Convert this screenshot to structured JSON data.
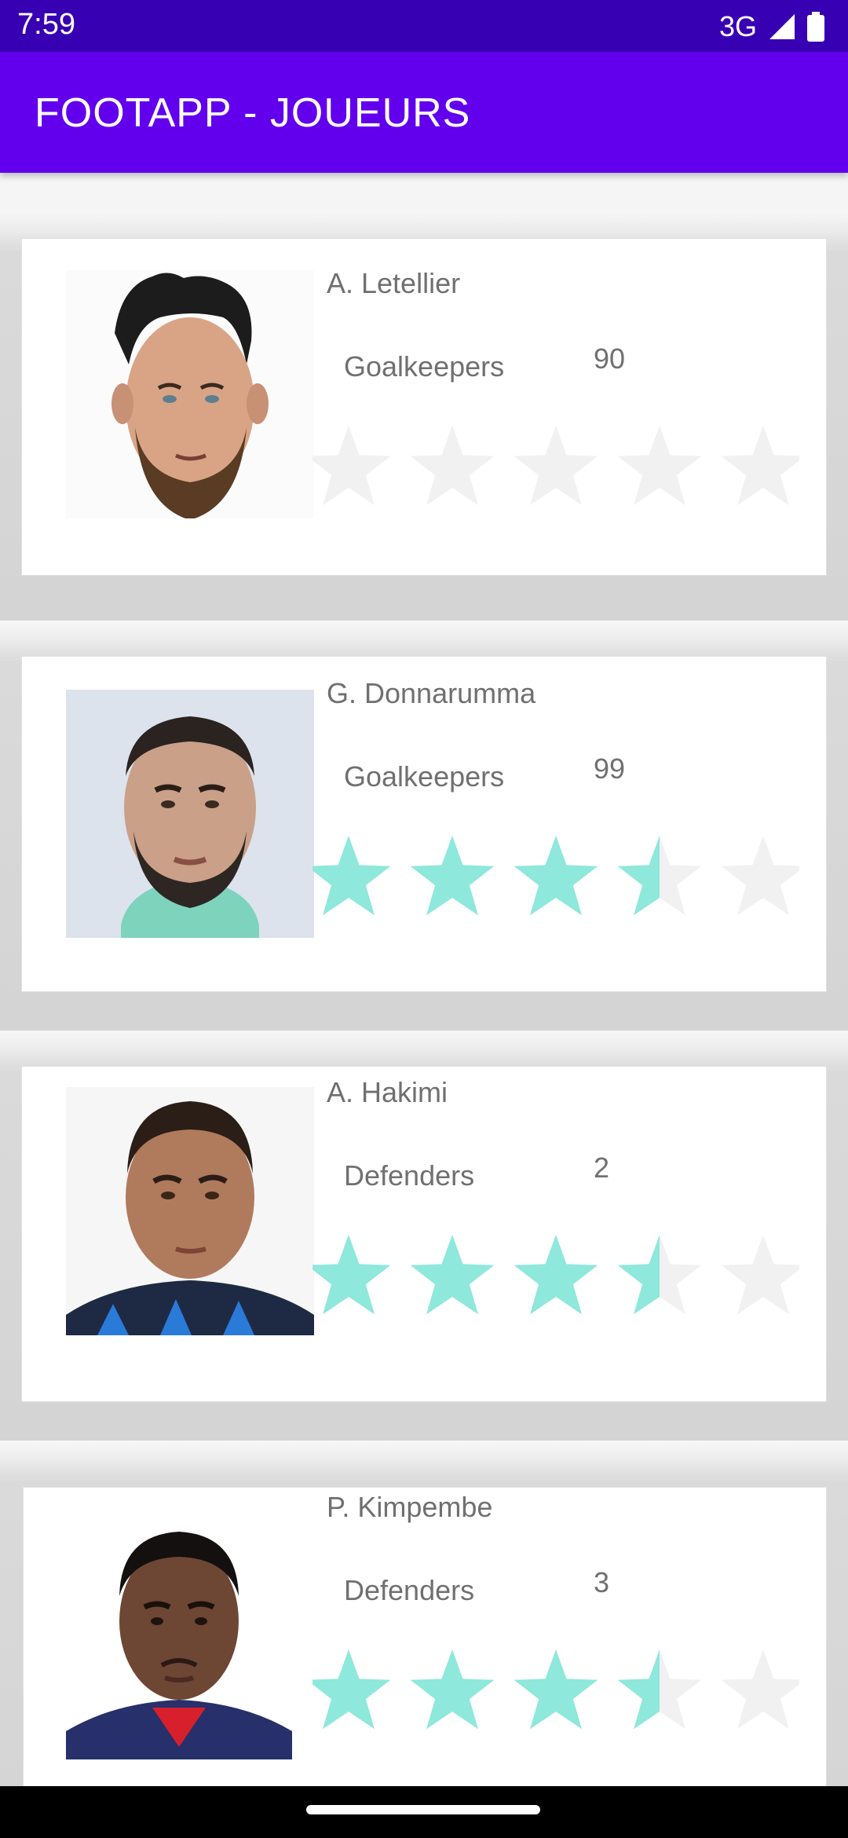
{
  "status": {
    "time": "7:59",
    "network": "3G"
  },
  "app_bar": {
    "title": "FOOTAPP - JOUEURS"
  },
  "colors": {
    "status_bar": "#3700b3",
    "app_bar": "#6200ee",
    "star_filled": "#8ee8dc",
    "star_empty": "#f1f1f1"
  },
  "players": [
    {
      "name": "A. Letellier",
      "position": "Goalkeepers",
      "number": "90",
      "rating": 0,
      "rating_max": 5
    },
    {
      "name": "G. Donnarumma",
      "position": "Goalkeepers",
      "number": "99",
      "rating": 3.5,
      "rating_max": 5
    },
    {
      "name": "A. Hakimi",
      "position": "Defenders",
      "number": "2",
      "rating": 3.5,
      "rating_max": 5
    },
    {
      "name": "P. Kimpembe",
      "position": "Defenders",
      "number": "3",
      "rating": 3.5,
      "rating_max": 5
    }
  ]
}
